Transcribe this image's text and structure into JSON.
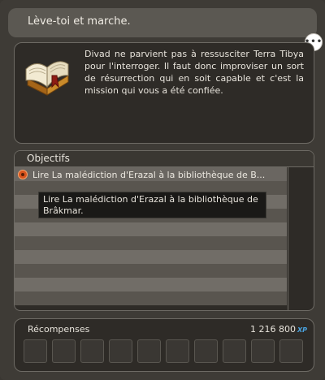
{
  "quest": {
    "title": "Lève-toi et marche.",
    "description": "Divad ne parvient pas à ressusciter Terra Tibya pour l'interroger. Il faut donc improviser un sort de résurrection qui en soit capable et c'est la mission qui vous a été confiée."
  },
  "chat_icon": {
    "icon": "speech-bubble-icon",
    "glyph": "•••"
  },
  "objectives": {
    "header": "Objectifs",
    "items": [
      {
        "text": "Lire La malédiction d'Erazal à la bibliothèque de B...",
        "icon": "objective-marker-icon"
      }
    ],
    "tooltip": "Lire La malédiction d'Erazal à la bibliothèque de Brâkmar."
  },
  "rewards": {
    "label": "Récompenses",
    "xp_value": "1 216 800",
    "xp_unit": "XP",
    "slots": 10
  },
  "colors": {
    "background": "#3e3b36",
    "panel": "#2e2b27",
    "objective_marker": "#d9541d",
    "xp_accent": "#4aa3e0"
  }
}
